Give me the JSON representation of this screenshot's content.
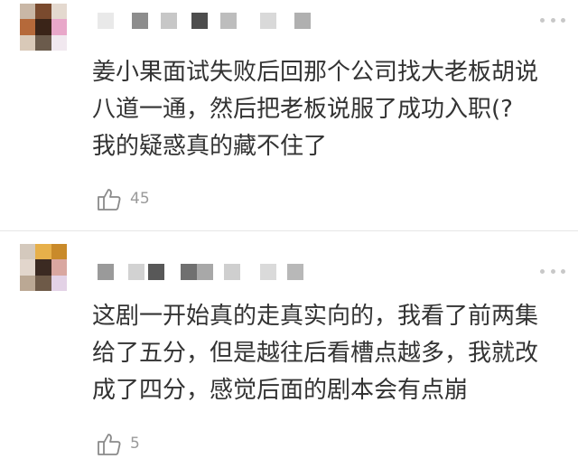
{
  "comments": [
    {
      "text": "姜小果面试失败后回那个公司找大老板胡说\n八道一通，然后把老板说服了成功入职(?\n我的疑惑真的藏不住了",
      "likes": "45",
      "icons": {
        "like": "thumbs-up-icon",
        "more": "more-dots-icon"
      }
    },
    {
      "text": "这剧一开始真的走真实向的，我看了前两集\n给了五分，但是越往后看槽点越多，我就改\n成了四分，感觉后面的剧本会有点崩",
      "likes": "5",
      "icons": {
        "like": "thumbs-up-icon",
        "more": "more-dots-icon"
      }
    }
  ],
  "colors": {
    "text": "#333333",
    "meta": "#9a9a9a",
    "divider": "#e6e6e6"
  }
}
